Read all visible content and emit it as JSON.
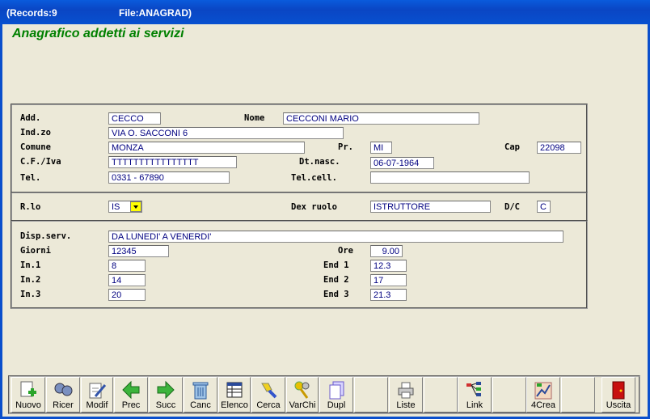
{
  "titlebar": {
    "records": "(Records:9",
    "file": "File:ANAGRAD)"
  },
  "app_title": "Anagrafico addetti ai servizi",
  "section1": {
    "add_label": "Add.",
    "add_value": "CECCO",
    "nome_label": "Nome",
    "nome_value": "CECCONI MARIO",
    "indzo_label": "Ind.zo",
    "indzo_value": "VIA O. SACCONI 6",
    "comune_label": "Comune",
    "comune_value": "MONZA",
    "pr_label": "Pr.",
    "pr_value": "MI",
    "cap_label": "Cap",
    "cap_value": "22098",
    "cf_label": "C.F./Iva",
    "cf_value": "TTTTTTTTTTTTTTTT",
    "dtnasc_label": "Dt.nasc.",
    "dtnasc_value": "06-07-1964",
    "tel_label": "Tel.",
    "tel_value": "0331 - 67890",
    "telcell_label": "Tel.cell.",
    "telcell_value": ""
  },
  "section2": {
    "rlo_label": "R.lo",
    "rlo_value": "IS",
    "dexruolo_label": "Dex ruolo",
    "dexruolo_value": "ISTRUTTORE",
    "dc_label": "D/C",
    "dc_value": "C"
  },
  "section3": {
    "disp_label": "Disp.serv.",
    "disp_value": "DA LUNEDI' A VENERDI'",
    "giorni_label": "Giorni",
    "giorni_value": "12345",
    "ore_label": "Ore",
    "ore_value": "9.00",
    "in1_label": "In.1",
    "in1_value": "8",
    "end1_label": "End 1",
    "end1_value": "12.3",
    "in2_label": "In.2",
    "in2_value": "14",
    "end2_label": "End 2",
    "end2_value": "17",
    "in3_label": "In.3",
    "in3_value": "20",
    "end3_label": "End 3",
    "end3_value": "21.3"
  },
  "toolbar": {
    "nuovo": "Nuovo",
    "ricer": "Ricer",
    "modif": "Modif",
    "prec": "Prec",
    "succ": "Succ",
    "canc": "Canc",
    "elenco": "Elenco",
    "cerca": "Cerca",
    "varchi": "VarChi",
    "dupl": "Dupl",
    "liste": "Liste",
    "link": "Link",
    "crea": "4Crea",
    "uscita": "Uscita"
  }
}
